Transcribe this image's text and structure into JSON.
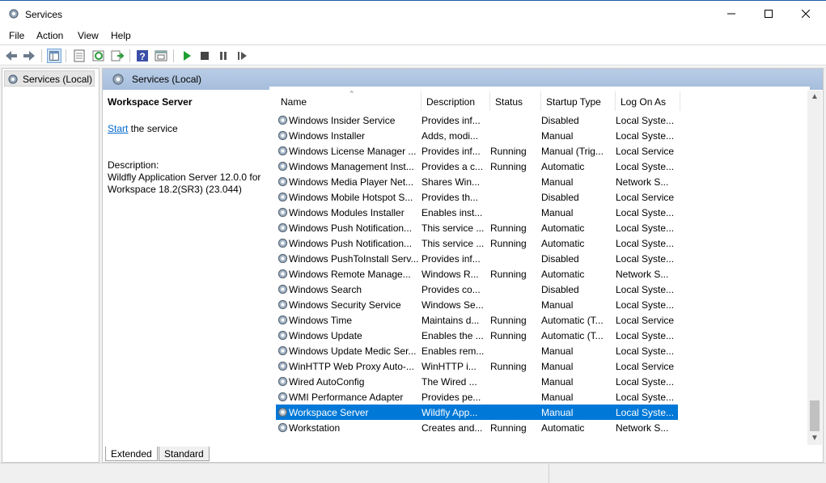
{
  "window": {
    "title": "Services",
    "controls": {
      "minimize": "minimize",
      "maximize": "maximize",
      "close": "close"
    }
  },
  "menu": [
    "File",
    "Action",
    "View",
    "Help"
  ],
  "tree": {
    "root_label": "Services (Local)"
  },
  "content_header": {
    "title": "Services (Local)"
  },
  "desc_pane": {
    "service_name": "Workspace Server",
    "start_link": "Start",
    "start_suffix": " the service",
    "description_label": "Description:",
    "description_text": "Wildfly Application Server 12.0.0 for Workspace 18.2(SR3) (23.044)"
  },
  "columns": [
    "Name",
    "Description",
    "Status",
    "Startup Type",
    "Log On As"
  ],
  "rows": [
    {
      "name": "Windows Insider Service",
      "description": "Provides inf...",
      "status": "",
      "startup": "Disabled",
      "logon": "Local Syste..."
    },
    {
      "name": "Windows Installer",
      "description": "Adds, modi...",
      "status": "",
      "startup": "Manual",
      "logon": "Local Syste..."
    },
    {
      "name": "Windows License Manager ...",
      "description": "Provides inf...",
      "status": "Running",
      "startup": "Manual (Trig...",
      "logon": "Local Service"
    },
    {
      "name": "Windows Management Inst...",
      "description": "Provides a c...",
      "status": "Running",
      "startup": "Automatic",
      "logon": "Local Syste..."
    },
    {
      "name": "Windows Media Player Net...",
      "description": "Shares Win...",
      "status": "",
      "startup": "Manual",
      "logon": "Network S..."
    },
    {
      "name": "Windows Mobile Hotspot S...",
      "description": "Provides th...",
      "status": "",
      "startup": "Disabled",
      "logon": "Local Service"
    },
    {
      "name": "Windows Modules Installer",
      "description": "Enables inst...",
      "status": "",
      "startup": "Manual",
      "logon": "Local Syste..."
    },
    {
      "name": "Windows Push Notification...",
      "description": "This service ...",
      "status": "Running",
      "startup": "Automatic",
      "logon": "Local Syste..."
    },
    {
      "name": "Windows Push Notification...",
      "description": "This service ...",
      "status": "Running",
      "startup": "Automatic",
      "logon": "Local Syste..."
    },
    {
      "name": "Windows PushToInstall Serv...",
      "description": "Provides inf...",
      "status": "",
      "startup": "Disabled",
      "logon": "Local Syste..."
    },
    {
      "name": "Windows Remote Manage...",
      "description": "Windows R...",
      "status": "Running",
      "startup": "Automatic",
      "logon": "Network S..."
    },
    {
      "name": "Windows Search",
      "description": "Provides co...",
      "status": "",
      "startup": "Disabled",
      "logon": "Local Syste..."
    },
    {
      "name": "Windows Security Service",
      "description": "Windows Se...",
      "status": "",
      "startup": "Manual",
      "logon": "Local Syste..."
    },
    {
      "name": "Windows Time",
      "description": "Maintains d...",
      "status": "Running",
      "startup": "Automatic (T...",
      "logon": "Local Service"
    },
    {
      "name": "Windows Update",
      "description": "Enables the ...",
      "status": "Running",
      "startup": "Automatic (T...",
      "logon": "Local Syste..."
    },
    {
      "name": "Windows Update Medic Ser...",
      "description": "Enables rem...",
      "status": "",
      "startup": "Manual",
      "logon": "Local Syste..."
    },
    {
      "name": "WinHTTP Web Proxy Auto-...",
      "description": "WinHTTP i...",
      "status": "Running",
      "startup": "Manual",
      "logon": "Local Service"
    },
    {
      "name": "Wired AutoConfig",
      "description": "The Wired ...",
      "status": "",
      "startup": "Manual",
      "logon": "Local Syste..."
    },
    {
      "name": "WMI Performance Adapter",
      "description": "Provides pe...",
      "status": "",
      "startup": "Manual",
      "logon": "Local Syste..."
    },
    {
      "name": "Workspace Server",
      "description": "Wildfly App...",
      "status": "",
      "startup": "Manual",
      "logon": "Local Syste...",
      "selected": true
    },
    {
      "name": "Workstation",
      "description": "Creates and...",
      "status": "Running",
      "startup": "Automatic",
      "logon": "Network S..."
    }
  ],
  "tabs": {
    "extended": "Extended",
    "standard": "Standard"
  },
  "colors": {
    "selection": "#0078d7",
    "link": "#0066cc",
    "header_band": "#b9cde6"
  },
  "toolbar_icons": [
    "back-icon",
    "forward-icon",
    "show-hide-tree-icon",
    "properties-icon",
    "refresh-icon",
    "export-list-icon",
    "help-icon",
    "mmc-view-icon",
    "start-service-icon",
    "stop-service-icon",
    "pause-service-icon",
    "restart-service-icon"
  ]
}
